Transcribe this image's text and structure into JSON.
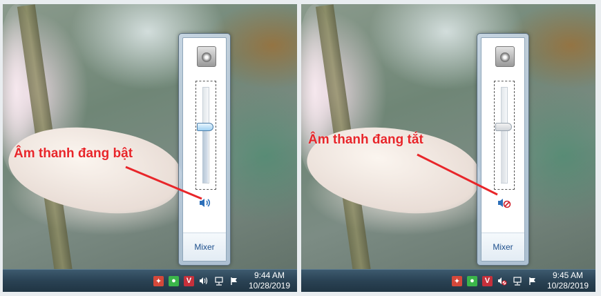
{
  "left": {
    "annotation": "Âm thanh đang bật",
    "mixer_link": "Mixer",
    "volume_state": "on",
    "clock_time": "9:44 AM",
    "clock_date": "10/28/2019"
  },
  "right": {
    "annotation": "Âm thanh đang tắt",
    "mixer_link": "Mixer",
    "volume_state": "muted",
    "clock_time": "9:45 AM",
    "clock_date": "10/28/2019"
  },
  "icons": {
    "tray": [
      "fire-icon",
      "chat-icon",
      "v-icon",
      "speaker-icon",
      "network-icon",
      "flag-icon"
    ]
  },
  "colors": {
    "annotation": "#e8262a",
    "taskbar": "#2a4254",
    "link": "#1e4f8c",
    "thumb_active": "#9fd0f2"
  }
}
